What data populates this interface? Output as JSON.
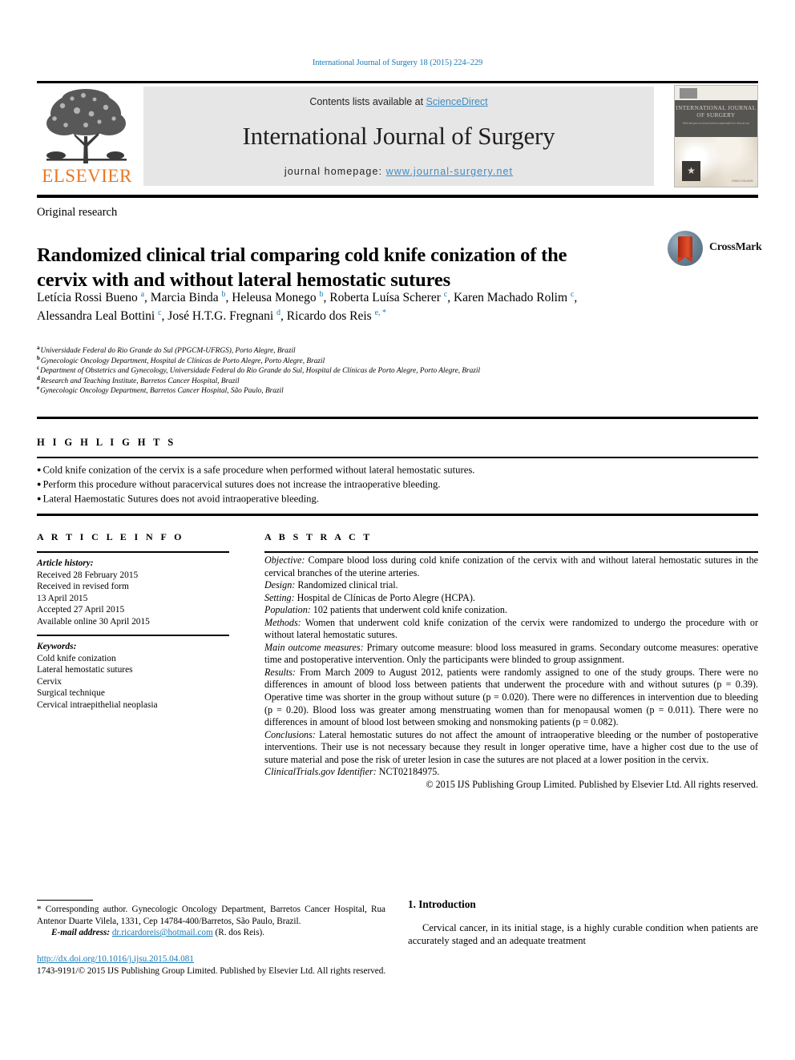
{
  "citation": "International Journal of Surgery 18 (2015) 224–229",
  "masthead": {
    "contents_prefix": "Contents lists available at ",
    "contents_link": "ScienceDirect",
    "journal_name": "International Journal of Surgery",
    "homepage_prefix": "journal homepage: ",
    "homepage_url": "www.journal-surgery.net",
    "publisher_logo_text": "ELSEVIER",
    "cover_title": "INTERNATIONAL JOURNAL OF SURGERY",
    "cover_subtitle": "Selected peer-reviewed and recommended for clinical use",
    "cover_footer": "ISSN 1743-9191"
  },
  "crossmark": {
    "label": "CrossMark"
  },
  "article": {
    "type": "Original research",
    "title": "Randomized clinical trial comparing cold knife conization of the cervix with and without lateral hemostatic sutures",
    "authors_html": "Letícia Rossi Bueno <sup class=\"sup\">a</sup>, Marcia Binda <sup class=\"sup\">b</sup>, Heleusa Monego <sup class=\"sup\">b</sup>, Roberta Luísa Scherer <sup class=\"sup\">c</sup>, Karen Machado Rolim <sup class=\"sup\">c</sup>, Alessandra Leal Bottini <sup class=\"sup\">c</sup>, José H.T.G. Fregnani <sup class=\"sup\">d</sup>, Ricardo dos Reis <sup class=\"sup\">e, *</sup>",
    "affiliations": [
      {
        "mark": "a",
        "text": "Universidade Federal do Rio Grande do Sul (PPGCM-UFRGS), Porto Alegre, Brazil"
      },
      {
        "mark": "b",
        "text": "Gynecologic Oncology Department, Hospital de Clínicas de Porto Alegre, Porto Alegre, Brazil"
      },
      {
        "mark": "c",
        "text": "Department of Obstetrics and Gynecology, Universidade Federal do Rio Grande do Sul, Hospital de Clínicas de Porto Alegre, Porto Alegre, Brazil"
      },
      {
        "mark": "d",
        "text": "Research and Teaching Institute, Barretos Cancer Hospital, Brazil"
      },
      {
        "mark": "e",
        "text": "Gynecologic Oncology Department, Barretos Cancer Hospital, São Paulo, Brazil"
      }
    ]
  },
  "highlights": {
    "heading": "H I G H L I G H T S",
    "items": [
      "Cold knife conization of the cervix is a safe procedure when performed without lateral hemostatic sutures.",
      "Perform this procedure without paracervical sutures does not increase the intraoperative bleeding.",
      "Lateral Haemostatic Sutures does not avoid intraoperative bleeding."
    ]
  },
  "article_info": {
    "heading": "A R T I C L E   I N F O",
    "history_label": "Article history:",
    "history": [
      "Received 28 February 2015",
      "Received in revised form",
      "13 April 2015",
      "Accepted 27 April 2015",
      "Available online 30 April 2015"
    ],
    "keywords_label": "Keywords:",
    "keywords": [
      "Cold knife conization",
      "Lateral hemostatic sutures",
      "Cervix",
      "Surgical technique",
      "Cervical intraepithelial neoplasia"
    ]
  },
  "abstract": {
    "heading": "A B S T R A C T",
    "sections": [
      {
        "label": "Objective:",
        "text": " Compare blood loss during cold knife conization of the cervix with and without lateral hemostatic sutures in the cervical branches of the uterine arteries."
      },
      {
        "label": "Design:",
        "text": " Randomized clinical trial."
      },
      {
        "label": "Setting:",
        "text": " Hospital de Clínicas de Porto Alegre (HCPA)."
      },
      {
        "label": "Population:",
        "text": " 102 patients that underwent cold knife conization."
      },
      {
        "label": "Methods:",
        "text": " Women that underwent cold knife conization of the cervix were randomized to undergo the procedure with or without lateral hemostatic sutures."
      },
      {
        "label": "Main outcome measures:",
        "text": " Primary outcome measure: blood loss measured in grams. Secondary outcome measures: operative time and postoperative intervention. Only the participants were blinded to group assignment."
      },
      {
        "label": "Results:",
        "text": " From March 2009 to August 2012, patients were randomly assigned to one of the study groups. There were no differences in amount of blood loss between patients that underwent the procedure with and without sutures (p = 0.39). Operative time was shorter in the group without suture (p = 0.020). There were no differences in intervention due to bleeding (p = 0.20). Blood loss was greater among menstruating women than for menopausal women (p = 0.011). There were no differences in amount of blood lost between smoking and nonsmoking patients (p = 0.082)."
      },
      {
        "label": "Conclusions:",
        "text": " Lateral hemostatic sutures do not affect the amount of intraoperative bleeding or the number of postoperative interventions. Their use is not necessary because they result in longer operative time, have a higher cost due to the use of suture material and pose the risk of ureter lesion in case the sutures are not placed at a lower position in the cervix."
      },
      {
        "label": "ClinicalTrials.gov Identifier:",
        "text": " NCT02184975."
      }
    ],
    "copyright": "© 2015 IJS Publishing Group Limited. Published by Elsevier Ltd. All rights reserved."
  },
  "footer": {
    "corresponding_mark": "*",
    "corresponding_text": " Corresponding author. Gynecologic Oncology Department, Barretos Cancer Hospital, Rua Antenor Duarte Vilela, 1331, Cep 14784-400/Barretos, São Paulo, Brazil.",
    "email_label": "E-mail address:",
    "email": "dr.ricardoreis@hotmail.com",
    "email_owner": "(R. dos Reis).",
    "doi_url": "http://dx.doi.org/10.1016/j.ijsu.2015.04.081",
    "issn_line": "1743-9191/© 2015 IJS Publishing Group Limited. Published by Elsevier Ltd. All rights reserved."
  },
  "introduction": {
    "heading": "1. Introduction",
    "paragraph": "Cervical cancer, in its initial stage, is a highly curable condition when patients are accurately staged and an adequate treatment"
  }
}
